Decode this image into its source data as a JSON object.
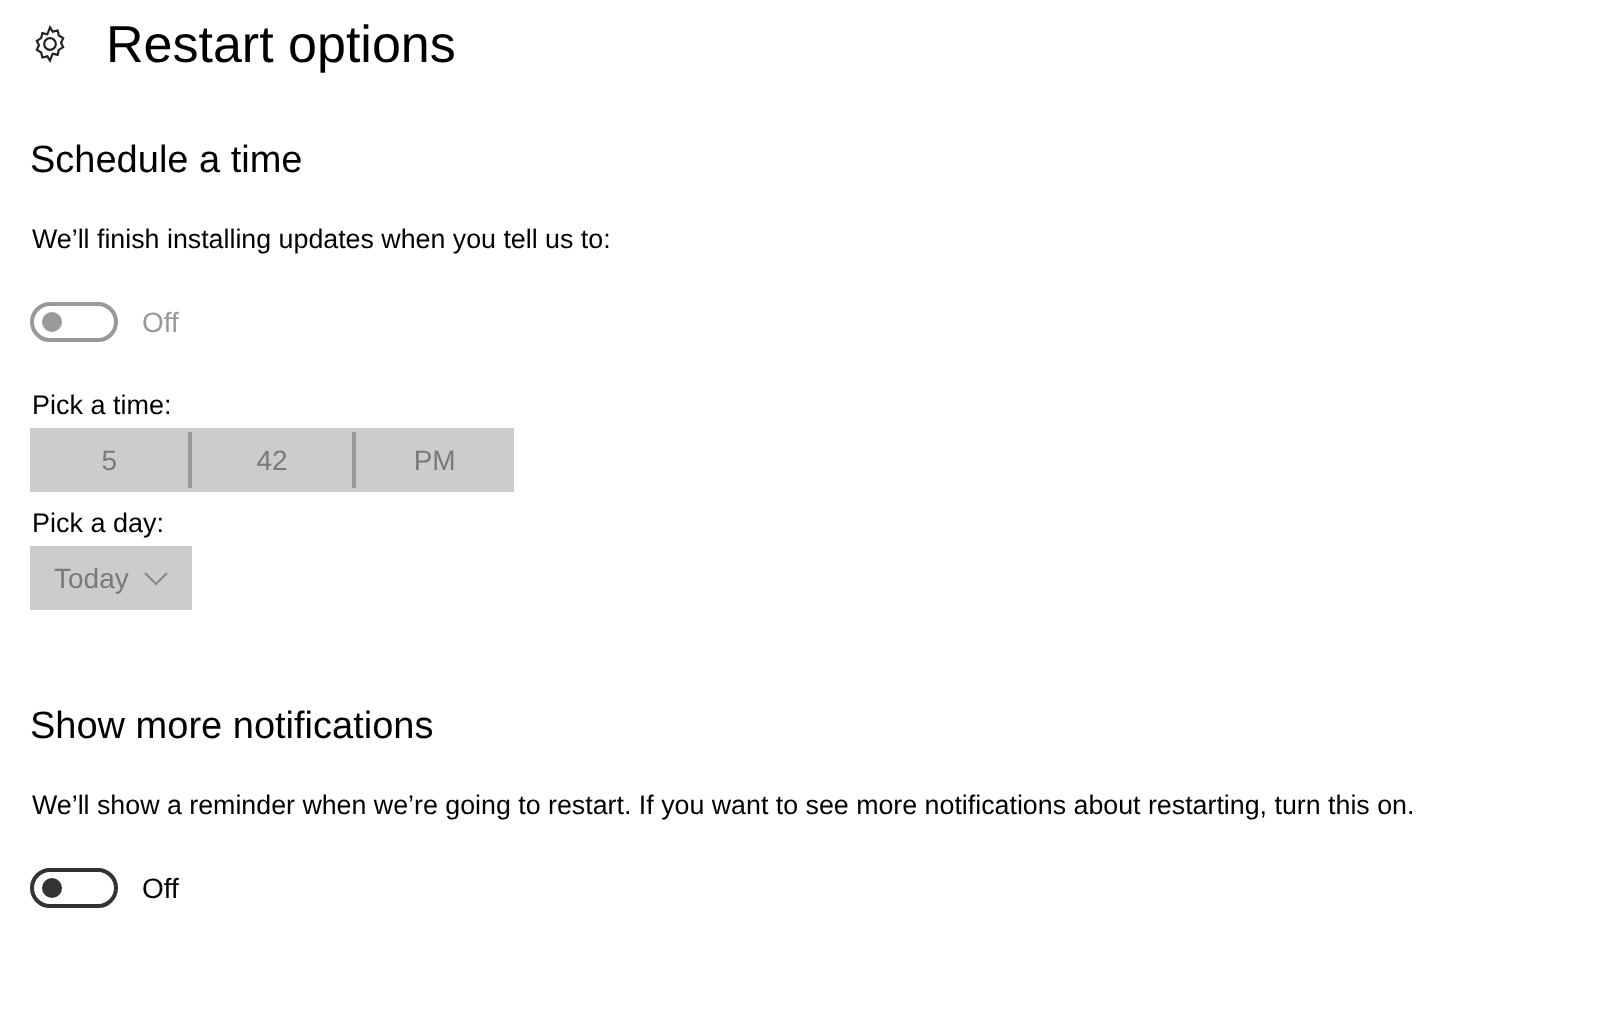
{
  "page": {
    "title": "Restart options"
  },
  "sections": [
    {
      "title": "Schedule a time",
      "description": "We’ll finish installing updates when you tell us to:",
      "toggle": {
        "on": false,
        "disabled": true,
        "label": "Off"
      },
      "time_picker": {
        "label": "Pick a time:",
        "disabled": true,
        "parts": [
          "5",
          "42",
          "PM"
        ]
      },
      "day_picker": {
        "label": "Pick a day:",
        "disabled": true,
        "value": "Today"
      }
    },
    {
      "title": "Show more notifications",
      "description": "We’ll show a reminder when we’re going to restart. If you want to see more notifications about restarting, turn this on.",
      "toggle": {
        "on": false,
        "disabled": false,
        "label": "Off"
      }
    }
  ]
}
